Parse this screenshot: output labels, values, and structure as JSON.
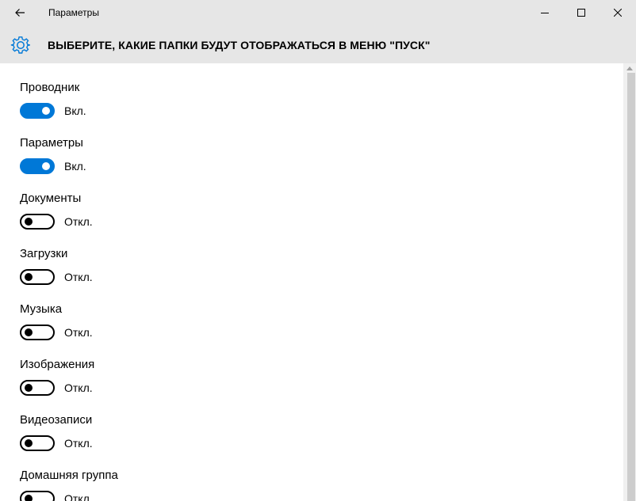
{
  "window": {
    "title": "Параметры"
  },
  "header": {
    "title": "ВЫБЕРИТЕ, КАКИЕ ПАПКИ БУДУТ ОТОБРАЖАТЬСЯ В МЕНЮ \"ПУСК\""
  },
  "icons": {
    "back": "arrow-left-icon",
    "minimize": "minimize-icon",
    "maximize": "maximize-icon",
    "close": "close-icon",
    "settings": "gear-icon"
  },
  "colors": {
    "accent": "#0078d7",
    "titlebar": "#e6e6e6"
  },
  "settings": [
    {
      "label": "Проводник",
      "state": "Вкл.",
      "on": true
    },
    {
      "label": "Параметры",
      "state": "Вкл.",
      "on": true
    },
    {
      "label": "Документы",
      "state": "Откл.",
      "on": false
    },
    {
      "label": "Загрузки",
      "state": "Откл.",
      "on": false
    },
    {
      "label": "Музыка",
      "state": "Откл.",
      "on": false
    },
    {
      "label": "Изображения",
      "state": "Откл.",
      "on": false
    },
    {
      "label": "Видеозаписи",
      "state": "Откл.",
      "on": false
    },
    {
      "label": "Домашняя группа",
      "state": "Откл.",
      "on": false
    }
  ]
}
